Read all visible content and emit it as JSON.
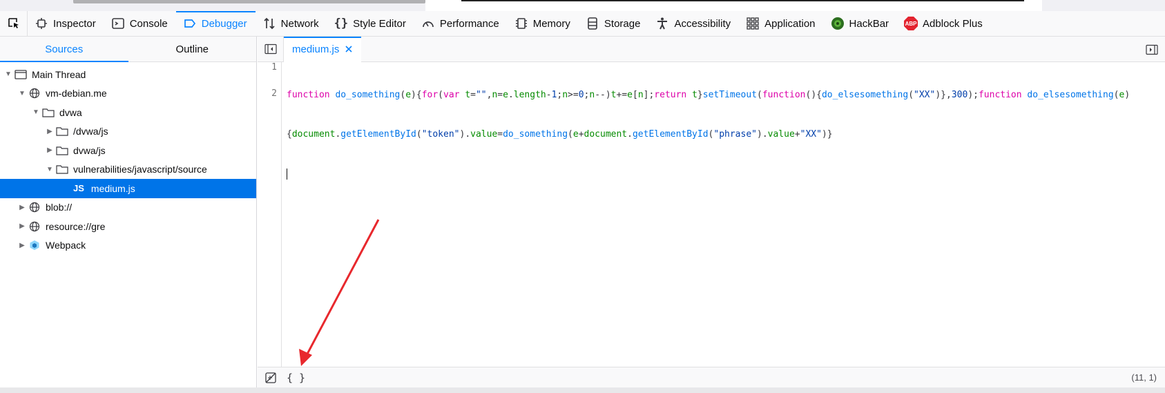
{
  "toolbar": {
    "tabs": [
      {
        "label": "Inspector",
        "icon": "inspector-icon"
      },
      {
        "label": "Console",
        "icon": "console-icon"
      },
      {
        "label": "Debugger",
        "icon": "debugger-icon",
        "active": true
      },
      {
        "label": "Network",
        "icon": "network-icon"
      },
      {
        "label": "Style Editor",
        "icon": "style-editor-icon"
      },
      {
        "label": "Performance",
        "icon": "performance-icon"
      },
      {
        "label": "Memory",
        "icon": "memory-icon"
      },
      {
        "label": "Storage",
        "icon": "storage-icon"
      },
      {
        "label": "Accessibility",
        "icon": "accessibility-icon"
      },
      {
        "label": "Application",
        "icon": "application-icon"
      },
      {
        "label": "HackBar",
        "icon": "hackbar-icon"
      },
      {
        "label": "Adblock Plus",
        "icon": "adblock-plus-icon",
        "badge": "ABP"
      }
    ]
  },
  "sidebar": {
    "tabs": [
      {
        "label": "Sources",
        "active": true
      },
      {
        "label": "Outline"
      }
    ],
    "tree": [
      {
        "label": "Main Thread",
        "icon": "thread-icon",
        "expanded": true
      },
      {
        "label": "vm-debian.me",
        "icon": "globe-icon",
        "expanded": true
      },
      {
        "label": "dvwa",
        "icon": "folder-icon",
        "expanded": true
      },
      {
        "label": "/dvwa/js",
        "icon": "folder-icon",
        "expanded": false
      },
      {
        "label": "dvwa/js",
        "icon": "folder-icon",
        "expanded": false
      },
      {
        "label": "vulnerabilities/javascript/source",
        "icon": "folder-icon",
        "expanded": true
      },
      {
        "label": "medium.js",
        "icon": "js-file-icon",
        "badge": "JS",
        "selected": true
      },
      {
        "label": "blob://",
        "icon": "globe-icon",
        "expanded": false
      },
      {
        "label": "resource://gre",
        "icon": "globe-icon",
        "expanded": false
      },
      {
        "label": "Webpack",
        "icon": "webpack-icon",
        "expanded": false
      }
    ]
  },
  "editor": {
    "tab_label": "medium.js",
    "line_numbers": [
      "1",
      "2"
    ],
    "code_line1": "function do_something(e){for(var t=\"\",n=e.length-1;n>=0;n--)t+=e[n];return t}setTimeout(function(){do_elsesomething(\"XX\")},300);function do_elsesomething(e)",
    "code_line1_wrap": "{document.getElementById(\"token\").value=do_something(e+document.getElementById(\"phrase\").value+\"XX\")}",
    "code_line2": ""
  },
  "footer": {
    "pretty_print_label": "{ }",
    "cursor_position": "(11, 1)"
  },
  "colors": {
    "accent": "#0a84ff",
    "selected_row": "#0074e8",
    "keyword": "#dd00a9",
    "function_name": "#0074e8",
    "variable": "#058b00",
    "string": "#003eaa",
    "annotation_arrow": "#e8282d"
  }
}
